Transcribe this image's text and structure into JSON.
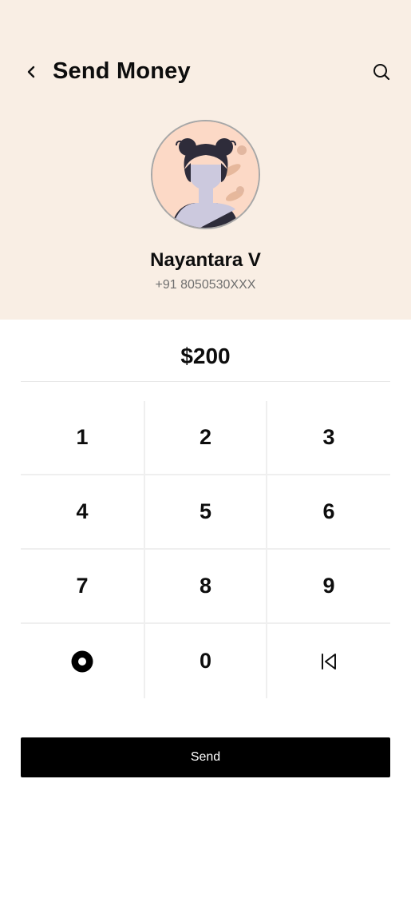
{
  "header": {
    "back_icon": "chevron-left-icon",
    "title": "Send Money",
    "search_icon": "search-icon"
  },
  "recipient": {
    "avatar": "avatar-illustration",
    "name": "Nayantara V",
    "phone": "+91 8050530XXX"
  },
  "amount": {
    "value": "$200"
  },
  "keypad": {
    "keys": [
      "1",
      "2",
      "3",
      "4",
      "5",
      "6",
      "7",
      "8",
      "9",
      "0"
    ],
    "dot_icon": "dot-icon",
    "backspace_icon": "skip-back-icon"
  },
  "actions": {
    "send_label": "Send"
  },
  "colors": {
    "header_bg": "#f9eee4",
    "avatar_bg": "#fcd9c6",
    "button_bg": "#000000"
  }
}
